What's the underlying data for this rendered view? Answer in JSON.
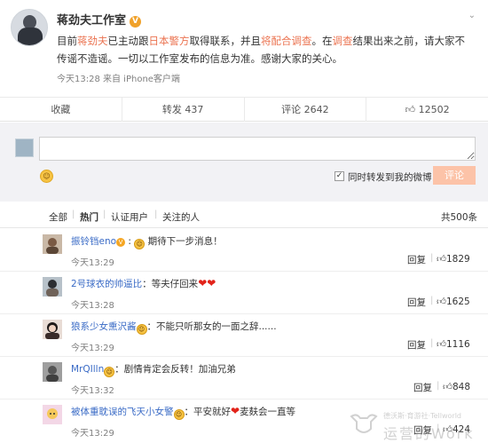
{
  "post": {
    "author": "蒋劲夫工作室",
    "verified_badge": "V",
    "text_parts": [
      "目前",
      "蒋劲夫",
      "已主动跟",
      "日本警方",
      "取得联系，并且",
      "将配合调查",
      "。在",
      "调查",
      "结果出来之前，请大家不传谣不造谣。一切以工作室发布的信息为准。感谢大家的关心。"
    ],
    "meta": "今天13:28 来自 iPhone客户端"
  },
  "actions": {
    "collect": "收藏",
    "repost": "转发 437",
    "comment": "评论 2642",
    "like": "12502"
  },
  "composer": {
    "input_value": "",
    "sync_label": "同时转发到我的微博",
    "submit_label": "评论"
  },
  "filters": {
    "all": "全部",
    "hot": "热门",
    "verified": "认证用户",
    "following": "关注的人",
    "total": "共500条"
  },
  "comments": [
    {
      "name": "振铃铛eno",
      "text_after": "期待下一步消息！",
      "time": "今天13:29",
      "reply": "回复",
      "likes": "1829"
    },
    {
      "name": "2号球衣的帅逼比",
      "text_after": "等夫仔回来",
      "time": "今天13:28",
      "reply": "回复",
      "likes": "1625"
    },
    {
      "name": "狼系少女熏沢酱",
      "text_after": "不能只听那女的一面之辞......",
      "time": "今天13:29",
      "reply": "回复",
      "likes": "1116"
    },
    {
      "name": "MrQIlln",
      "text_after": "剧情肯定会反转！加油兄弟",
      "time": "今天13:32",
      "reply": "回复",
      "likes": "848"
    },
    {
      "name": "被体重耽误的飞天小女警",
      "text_after": "平安就好",
      "text_tail": "麦麸会一直等",
      "time": "今天13:29",
      "reply": "回复",
      "likes": "424"
    }
  ],
  "watermark": {
    "small": "德沃斯·育游社·Tellworld",
    "big": "运营的Work"
  },
  "colors": {
    "link_red": "#eb7350",
    "name_blue": "#3a6bc6",
    "submit_disabled": "#fcc3a8",
    "verified_orange": "#f0a12a"
  }
}
